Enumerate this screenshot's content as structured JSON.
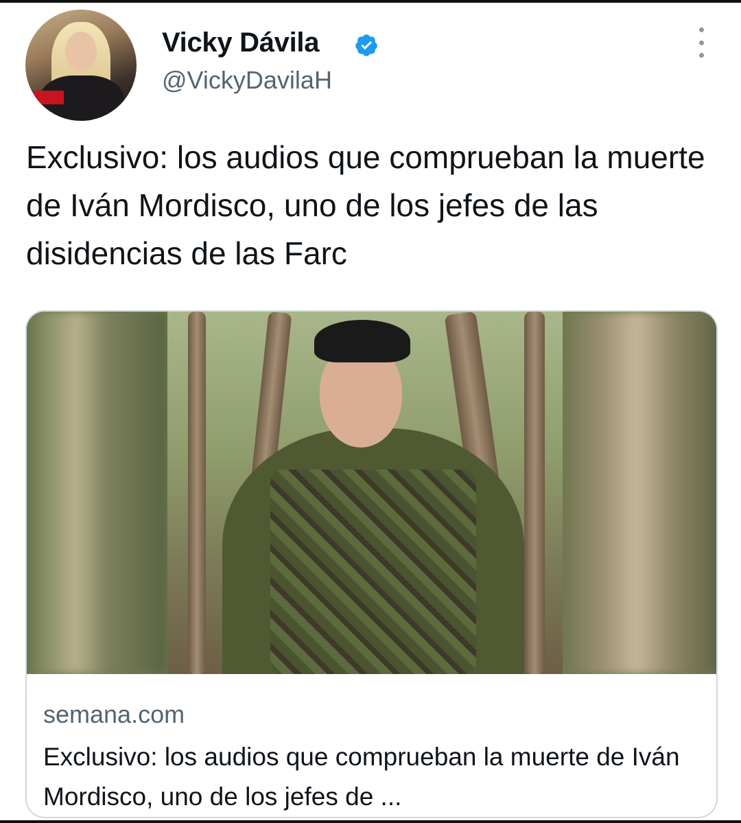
{
  "tweet": {
    "author": {
      "display_name": "Vicky Dávila",
      "handle": "@VickyDavilaH",
      "verified": true
    },
    "text": "Exclusivo: los audios que comprueban la muerte de Iván Mordisco, uno de los jefes de las disidencias de las Farc",
    "card": {
      "domain": "semana.com",
      "title": "Exclusivo: los audios que comprueban la muerte de Iván Mordisco, uno de los jefes de ..."
    }
  },
  "icons": {
    "verified": "verified-badge-icon",
    "more": "more-options-icon"
  },
  "colors": {
    "verified_blue": "#1d9bf0",
    "secondary_text": "#536471",
    "primary_text": "#0f1419",
    "card_border": "#cfd9de"
  }
}
